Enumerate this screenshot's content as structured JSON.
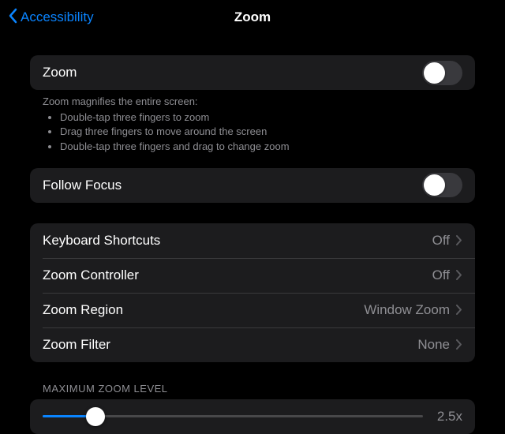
{
  "nav": {
    "back": "Accessibility",
    "title": "Zoom"
  },
  "zoomToggle": {
    "label": "Zoom",
    "on": false
  },
  "zoomHelp": {
    "intro": "Zoom magnifies the entire screen:",
    "items": [
      "Double-tap three fingers to zoom",
      "Drag three fingers to move around the screen",
      "Double-tap three fingers and drag to change zoom"
    ]
  },
  "followFocus": {
    "label": "Follow Focus",
    "on": false
  },
  "options": [
    {
      "label": "Keyboard Shortcuts",
      "value": "Off"
    },
    {
      "label": "Zoom Controller",
      "value": "Off"
    },
    {
      "label": "Zoom Region",
      "value": "Window Zoom"
    },
    {
      "label": "Zoom Filter",
      "value": "None"
    }
  ],
  "maxZoom": {
    "header": "MAXIMUM ZOOM LEVEL",
    "value": "2.5x",
    "percent": 14
  }
}
